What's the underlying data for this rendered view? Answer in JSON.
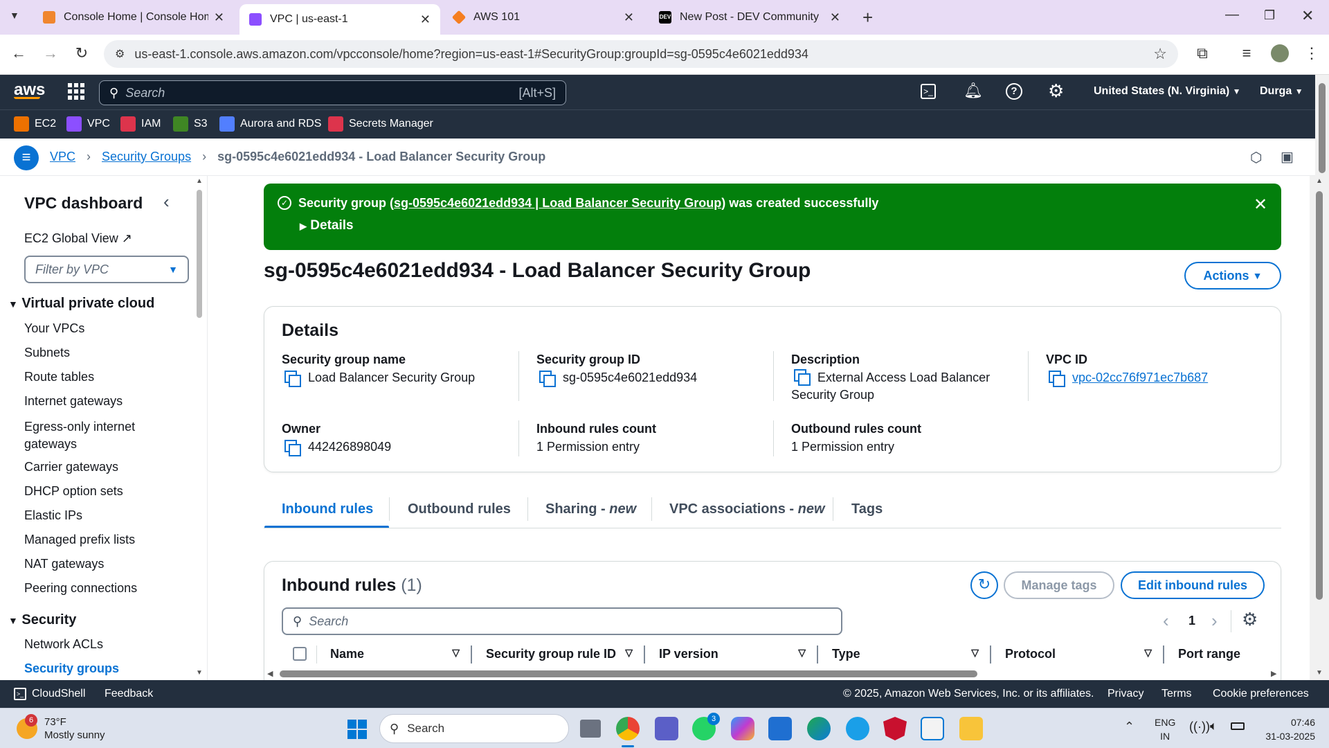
{
  "browser": {
    "tabs": [
      {
        "title": "Console Home | Console Home",
        "fav_color": "#f0862e"
      },
      {
        "title": "VPC | us-east-1",
        "fav_color": "#8c4fff"
      },
      {
        "title": "AWS 101",
        "fav_color": "#f57e20"
      },
      {
        "title": "New Post - DEV Community",
        "fav_color": "#000000",
        "fav_text": "DEV"
      }
    ],
    "url": "us-east-1.console.aws.amazon.com/vpcconsole/home?region=us-east-1#SecurityGroup:groupId=sg-0595c4e6021edd934"
  },
  "aws": {
    "search_placeholder": "Search",
    "search_shortcut": "[Alt+S]",
    "region": "United States (N. Virginia)",
    "user": "Durga",
    "favorites": [
      {
        "label": "EC2",
        "color": "#ed7100"
      },
      {
        "label": "VPC",
        "color": "#8c4fff"
      },
      {
        "label": "IAM",
        "color": "#dd344c"
      },
      {
        "label": "S3",
        "color": "#3f8624"
      },
      {
        "label": "Aurora and RDS",
        "color": "#527fff"
      },
      {
        "label": "Secrets Manager",
        "color": "#dd344c"
      }
    ]
  },
  "breadcrumb": {
    "c1": "VPC",
    "c2": "Security Groups",
    "c3": "sg-0595c4e6021edd934 - Load Balancer Security Group"
  },
  "sidebar": {
    "title": "VPC dashboard",
    "global_view": "EC2 Global View",
    "filter_placeholder": "Filter by VPC",
    "section1": "Virtual private cloud",
    "items": [
      "Your VPCs",
      "Subnets",
      "Route tables",
      "Internet gateways",
      "Egress-only internet gateways",
      "Carrier gateways",
      "DHCP option sets",
      "Elastic IPs",
      "Managed prefix lists",
      "NAT gateways",
      "Peering connections"
    ],
    "section2": "Security",
    "items2": [
      "Network ACLs",
      "Security groups"
    ]
  },
  "flash": {
    "prefix": "Security group (",
    "link": "sg-0595c4e6021edd934 | Load Balancer Security Group",
    "suffix": ") was created successfully",
    "details": "Details"
  },
  "page": {
    "title": "sg-0595c4e6021edd934 - Load Balancer Security Group",
    "actions": "Actions"
  },
  "details": {
    "heading": "Details",
    "sg_name_label": "Security group name",
    "sg_name": "Load Balancer Security Group",
    "sg_id_label": "Security group ID",
    "sg_id": "sg-0595c4e6021edd934",
    "desc_label": "Description",
    "desc": "External Access Load Balancer Security Group",
    "vpc_label": "VPC ID",
    "vpc": "vpc-02cc76f971ec7b687",
    "owner_label": "Owner",
    "owner": "442426898049",
    "inbound_label": "Inbound rules count",
    "inbound": "1 Permission entry",
    "outbound_label": "Outbound rules count",
    "outbound": "1 Permission entry"
  },
  "tabs": {
    "t1": "Inbound rules",
    "t2": "Outbound rules",
    "t3": "Sharing",
    "t3n": "new",
    "t4": "VPC associations",
    "t4n": "new",
    "t5": "Tags"
  },
  "rules": {
    "heading": "Inbound rules",
    "count": "(1)",
    "manage_tags": "Manage tags",
    "edit": "Edit inbound rules",
    "search_placeholder": "Search",
    "page": "1",
    "columns": [
      "Name",
      "Security group rule ID",
      "IP version",
      "Type",
      "Protocol",
      "Port range"
    ]
  },
  "footer": {
    "cloudshell": "CloudShell",
    "feedback": "Feedback",
    "copyright": "© 2025, Amazon Web Services, Inc. or its affiliates.",
    "privacy": "Privacy",
    "terms": "Terms",
    "cookies": "Cookie preferences"
  },
  "taskbar": {
    "weather_temp": "73°F",
    "weather_desc": "Mostly sunny",
    "weather_badge": "6",
    "search": "Search",
    "lang1": "ENG",
    "lang2": "IN",
    "time": "07:46",
    "date": "31-03-2025",
    "whatsapp_badge": "3"
  }
}
